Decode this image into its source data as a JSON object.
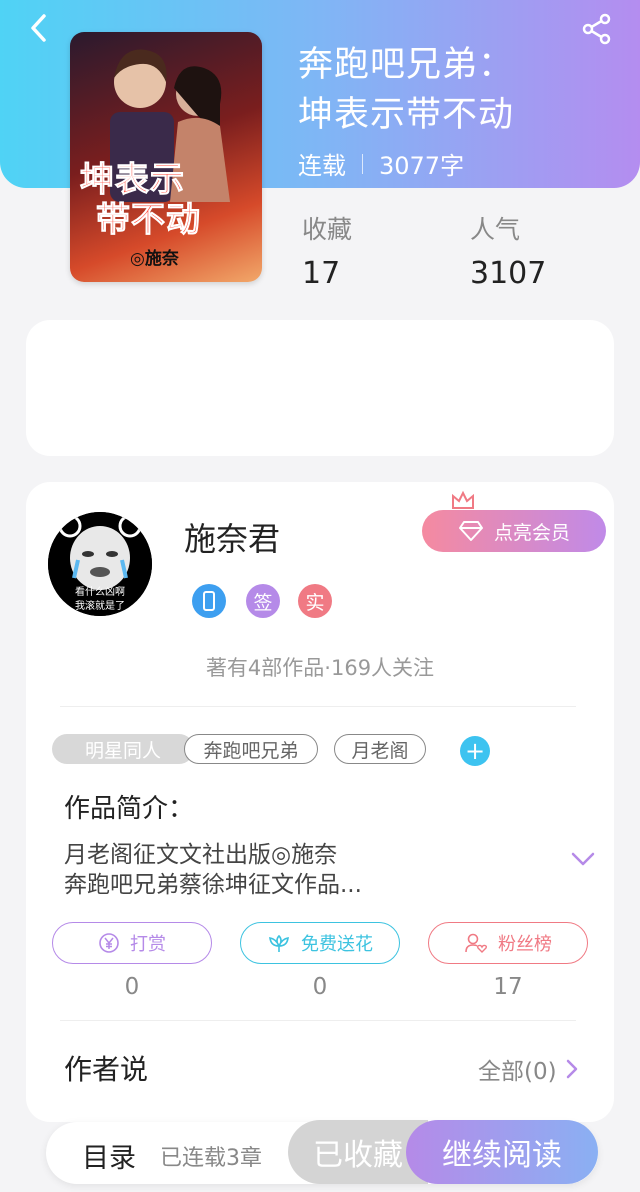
{
  "book": {
    "title_line1": "奔跑吧兄弟：",
    "title_line2": "坤表示带不动",
    "status": "连载",
    "word_count": "3077字",
    "cover_title_line1": "坤表示",
    "cover_title_line2": "带不动",
    "cover_author": "◎施奈"
  },
  "stats": {
    "collect_label": "收藏",
    "collect_value": "17",
    "popularity_label": "人气",
    "popularity_value": "3107"
  },
  "author": {
    "name": "施奈君",
    "vip_button": "点亮会员",
    "badge_sign": "签",
    "badge_real": "实",
    "works_summary": "著有4部作品·169人关注",
    "avatar_caption_line1": "看什么凶啊",
    "avatar_caption_line2": "我滚就是了"
  },
  "tags": [
    "明星同人",
    "奔跑吧兄弟",
    "月老阁"
  ],
  "tag_add": "+",
  "intro": {
    "heading": "作品简介：",
    "line1": "月老阁征文文社出版◎施奈",
    "line2": "奔跑吧兄弟蔡徐坤征文作品..."
  },
  "actions": [
    {
      "label": "打赏",
      "count": "0",
      "color": "#b58ae8"
    },
    {
      "label": "免费送花",
      "count": "0",
      "color": "#3dc3e0"
    },
    {
      "label": "粉丝榜",
      "count": "17",
      "color": "#f07a84"
    }
  ],
  "author_say": {
    "heading": "作者说",
    "all_label": "全部(0)"
  },
  "bottom": {
    "toc": "目录",
    "chapters": "已连载3章",
    "collected": "已收藏",
    "continue": "继续阅读"
  },
  "colors": {
    "accent_cyan": "#4fd3f5",
    "accent_purple": "#b48df0",
    "pink": "#f07a84"
  }
}
